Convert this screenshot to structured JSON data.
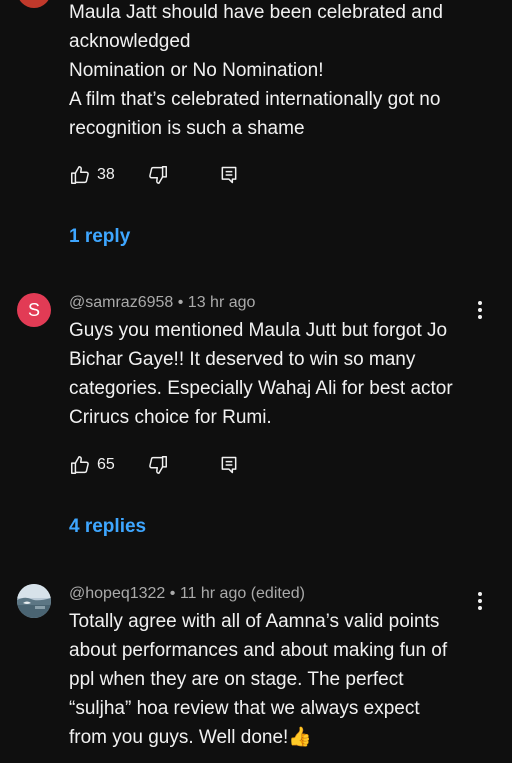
{
  "comments": [
    {
      "avatar_color": "#c0392b",
      "lines": [
        "Maula Jatt should have been celebrated and",
        "acknowledged",
        "Nomination or No Nomination!",
        "A film that’s celebrated internationally got no",
        "recognition is such a shame"
      ],
      "likes": "38",
      "replies_label": "1 reply"
    },
    {
      "avatar_letter": "S",
      "avatar_color": "#e23b55",
      "author": "@samraz6958",
      "time": "13 hr ago",
      "lines": [
        "Guys you mentioned Maula Jutt but forgot Jo",
        "Bichar Gaye!! It deserved to win so many",
        "categories. Especially Wahaj Ali for best actor",
        "Crirucs choice for Rumi."
      ],
      "likes": "65",
      "replies_label": "4 replies"
    },
    {
      "author": "@hopeq1322",
      "time": "11 hr ago (edited)",
      "lines": [
        "Totally agree with all of Aamna’s valid points",
        "about performances and about making fun of",
        "ppl when they are on stage. The perfect",
        "“suljha” hoa review that we always expect",
        "from you guys. Well done!👍"
      ]
    }
  ],
  "separator": " • ",
  "colors": {
    "background": "#0f0f0f",
    "text": "#f1f1f1",
    "meta": "#aaaaaa",
    "link": "#3ea6ff"
  },
  "icons": {
    "like": "thumbs-up-icon",
    "dislike": "thumbs-down-icon",
    "reply": "reply-icon",
    "more": "more-vert-icon"
  }
}
